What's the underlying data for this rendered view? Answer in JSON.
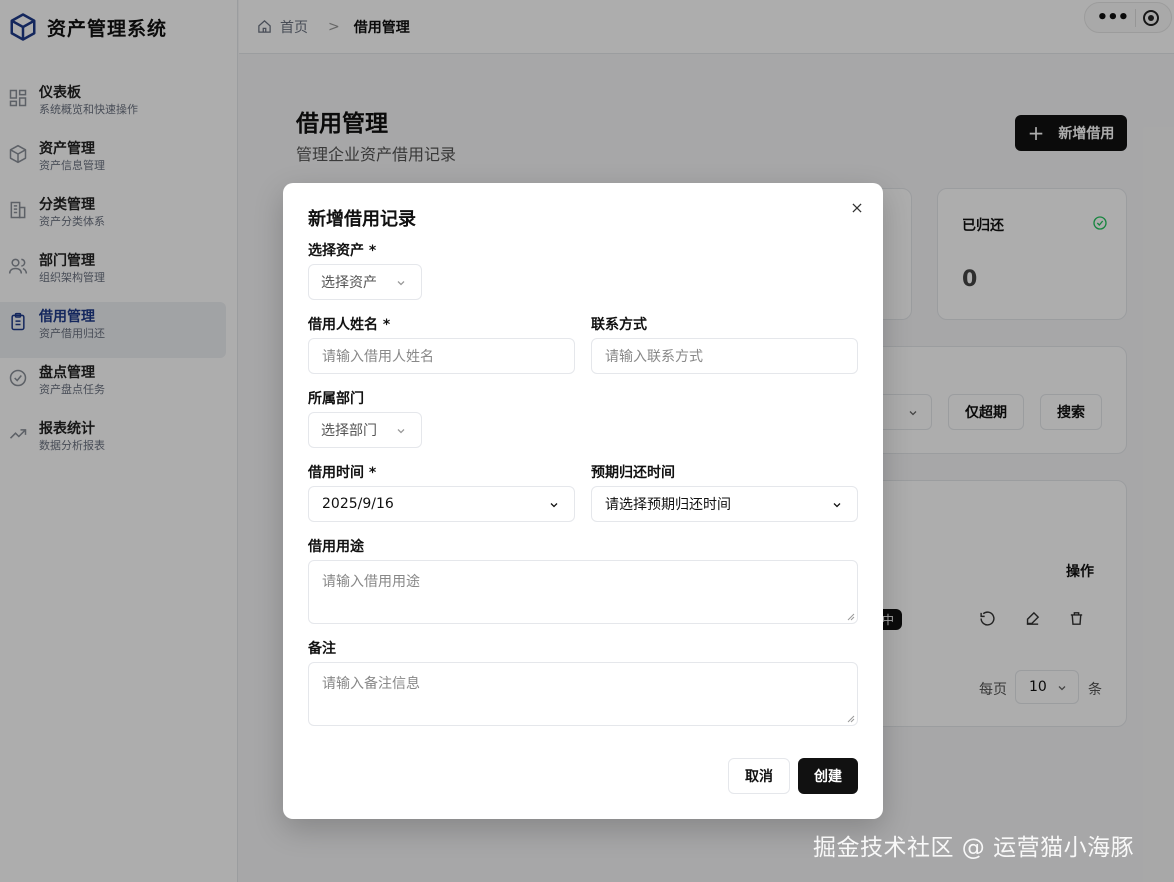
{
  "app": {
    "title": "资产管理系统"
  },
  "sidebar": {
    "items": [
      {
        "label": "仪表板",
        "sub": "系统概览和快速操作"
      },
      {
        "label": "资产管理",
        "sub": "资产信息管理"
      },
      {
        "label": "分类管理",
        "sub": "资产分类体系"
      },
      {
        "label": "部门管理",
        "sub": "组织架构管理"
      },
      {
        "label": "借用管理",
        "sub": "资产借用归还"
      },
      {
        "label": "盘点管理",
        "sub": "资产盘点任务"
      },
      {
        "label": "报表统计",
        "sub": "数据分析报表"
      }
    ],
    "active_index": 4
  },
  "breadcrumb": {
    "home": "首页",
    "current": "借用管理"
  },
  "main": {
    "title": "借用管理",
    "subtitle": "管理企业资产借用记录",
    "new_button": "新增借用",
    "stats": {
      "returned_label": "已归还",
      "returned_value": "0"
    },
    "filters": {
      "overdue_button": "仅超期",
      "search_button": "搜索"
    },
    "table": {
      "op_header": "操作",
      "status_partial": "中"
    },
    "pagination": {
      "per_page_label": "每页",
      "per_page_value": "10",
      "unit": "条"
    }
  },
  "modal": {
    "title": "新增借用记录",
    "asset": {
      "label": "选择资产 *",
      "placeholder": "选择资产"
    },
    "borrower": {
      "label": "借用人姓名 *",
      "placeholder": "请输入借用人姓名"
    },
    "contact": {
      "label": "联系方式",
      "placeholder": "请输入联系方式"
    },
    "department": {
      "label": "所属部门",
      "placeholder": "选择部门"
    },
    "borrow_time": {
      "label": "借用时间 *",
      "value": "2025/9/16"
    },
    "return_time": {
      "label": "预期归还时间",
      "value": "请选择预期归还时间"
    },
    "purpose": {
      "label": "借用用途",
      "placeholder": "请输入借用用途"
    },
    "remarks": {
      "label": "备注",
      "placeholder": "请输入备注信息"
    },
    "cancel": "取消",
    "create": "创建"
  },
  "watermark": "掘金技术社区 @ 运营猫小海豚",
  "colors": {
    "accent": "#1e3a8a",
    "primary_button": "#111111",
    "success": "#22c55e"
  }
}
